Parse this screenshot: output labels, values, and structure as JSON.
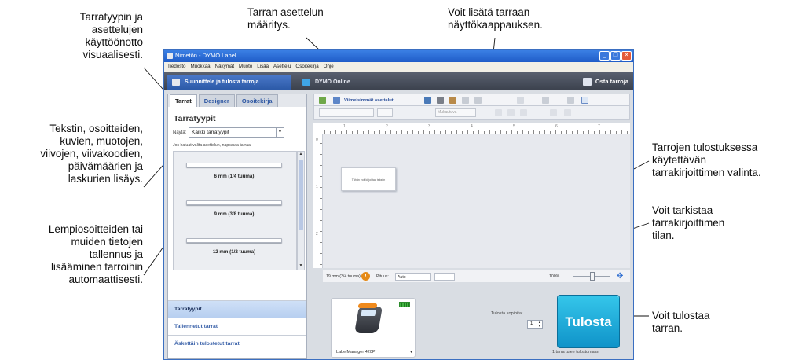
{
  "window": {
    "title": "Nimetön - DYMO Label",
    "controls": [
      "_",
      "❐",
      "✕"
    ]
  },
  "menu": [
    "Tiedosto",
    "Muokkaa",
    "Näkymät",
    "Muoto",
    "Lisää",
    "Asettelu",
    "Osoitekirja",
    "Ohje"
  ],
  "top_tabs": {
    "design": "Suunnittele ja tulosta tarroja",
    "online": "DYMO Online",
    "buy": "Osta tarroja"
  },
  "left_panel": {
    "tabs": [
      "Tarrat",
      "Designer",
      "Osoitekirja"
    ],
    "heading": "Tarratyypit",
    "show_label": "Näytä:",
    "show_value": "Kaikki tarratyypit",
    "hint": "Jos haluat valita asettelun, napsauta tarraa",
    "labels": [
      "6 mm (1/4 tuuma)",
      "9 mm (3/8 tuuma)",
      "12 mm (1/2 tuuma)"
    ],
    "nav": [
      "Tarratyypit",
      "Tallennetut tarrat",
      "Äskettäin tulostetut tarrat"
    ]
  },
  "toolbar": {
    "recent_layouts": "Viimeisimmät asettelut",
    "font_size": "Mukautuva"
  },
  "ruler": {
    "h_numbers": [
      "1",
      "2",
      "3",
      "4",
      "5",
      "6",
      "7"
    ],
    "v_numbers": [
      "0",
      "1",
      "2"
    ]
  },
  "label_preview_text": "Tähän voit kirjoittaa tekstin",
  "statusbar": {
    "tape": "19 mm (3/4 tuuma)",
    "length_label": "Pituus:",
    "length_value": "Auto",
    "zoom": "100%"
  },
  "printer": {
    "name": "LabelManager 420P"
  },
  "print": {
    "copies_label": "Tulosta kopioita:",
    "copies_value": "1",
    "button": "Tulosta",
    "hint": "1 tarra tulee tulostumaan"
  },
  "callouts": {
    "left_top": "Tarratyypin ja\nasettelujen\nkäyttöönotto\nvisuaalisesti.",
    "left_mid": "Tekstin, osoitteiden,\nkuvien, muotojen,\nviivojen, viivakoodien,\npäivämäärien ja\nlaskurien lisäys.",
    "left_bottom": "Lempiosoitteiden tai\nmuiden tietojen\ntallennus ja\nlisääminen tarroihin\nautomaattisesti.",
    "top_mid": "Tarran asettelun\nmääritys.",
    "top_right": "Voit lisätä tarraan\nnäyttökaappauksen.",
    "right_printer": "Tarrojen tulostuksessa\nkäytettävän\ntarrakirjoittimen valinta.",
    "right_status": "Voit tarkistaa\ntarrakirjoittimen\ntilan.",
    "right_print": "Voit tulostaa\ntarran."
  },
  "colors": {
    "title_bar": "#2b6cd8",
    "print_button": "#1aaad8",
    "active_nav": "#c3d6f3"
  }
}
